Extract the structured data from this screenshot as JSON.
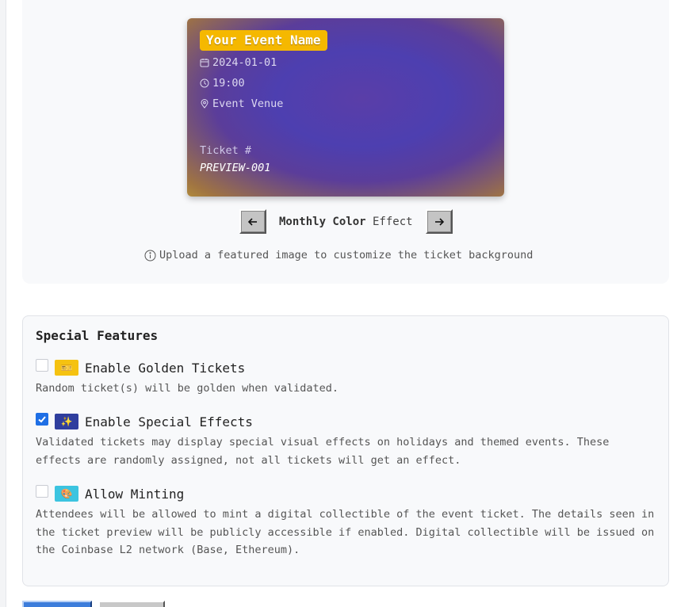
{
  "ticket_preview": {
    "event_name": "Your Event Name",
    "date": "2024-01-01",
    "time": "19:00",
    "venue": "Event Venue",
    "ticket_label": "Ticket #",
    "ticket_code": "PREVIEW-001"
  },
  "effect_selector": {
    "name_bold": "Monthly Color",
    "name_suffix": " Effect"
  },
  "hint_text": "Upload a featured image to customize the ticket background",
  "special_features": {
    "title": "Special Features",
    "items": [
      {
        "icon": "ticket-emoji-icon",
        "badge_glyph": "🎫",
        "badge_color": "#f5c211",
        "label": "Enable Golden Tickets",
        "checked": false,
        "description": "Random ticket(s) will be golden when validated."
      },
      {
        "icon": "sparkles-emoji-icon",
        "badge_glyph": "✨",
        "badge_color": "#2f3e9e",
        "label": "Enable Special Effects",
        "checked": true,
        "description": "Validated tickets may display special visual effects on holidays and themed events. These effects are randomly assigned, not all tickets will get an effect."
      },
      {
        "icon": "palette-emoji-icon",
        "badge_glyph": "🎨",
        "badge_color": "#3cc4e0",
        "label": "Allow Minting",
        "checked": false,
        "description": "Attendees will be allowed to mint a digital collectible of the event ticket. The details seen in the ticket preview will be publicly accessible if enabled. Digital collectible will be issued on the Coinbase L2 network (Base, Ethereum)."
      }
    ]
  },
  "colors": {
    "accent": "#1f6fe5",
    "event_name_bg": "#f5b800"
  }
}
